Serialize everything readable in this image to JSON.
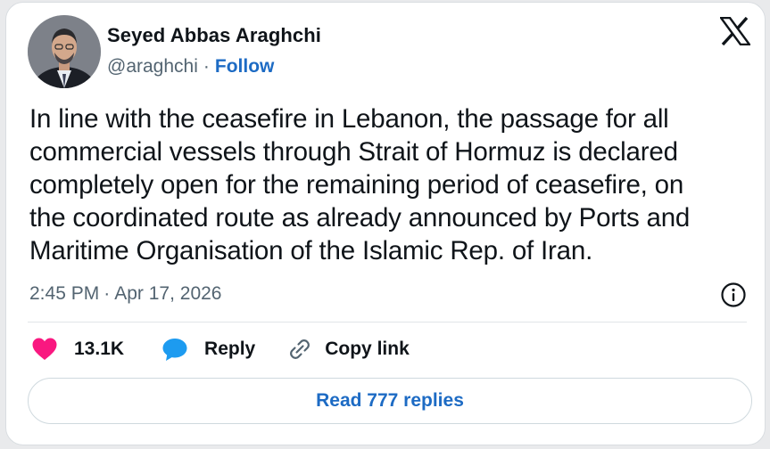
{
  "author": {
    "name": "Seyed Abbas Araghchi",
    "handle": "@araghchi",
    "separator": "·",
    "follow_label": "Follow"
  },
  "tweet": {
    "text_lines": [
      "In line with the ceasefire in Lebanon, the passage for all",
      "commercial vessels through Strait of Hormuz is declared",
      "completely open for the remaining period of ceasefire, on",
      "the coordinated route as already announced by Ports and",
      "Maritime Organisation of the Islamic Rep. of Iran."
    ],
    "time": "2:45 PM",
    "date_separator": "·",
    "date": "Apr 17, 2026"
  },
  "actions": {
    "like_count": "13.1K",
    "reply_label": "Reply",
    "copy_link_label": "Copy link"
  },
  "read_replies_label": "Read 777 replies",
  "colors": {
    "link_blue": "#1d6bc4",
    "heart_pink": "#f91880",
    "reply_blue": "#1d9bf0",
    "text_dark": "#0f1419",
    "text_muted": "#536471"
  },
  "icons": {
    "brand": "x-logo-icon",
    "info": "info-icon",
    "like": "heart-icon",
    "reply": "speech-bubble-icon",
    "copy_link": "link-icon"
  }
}
